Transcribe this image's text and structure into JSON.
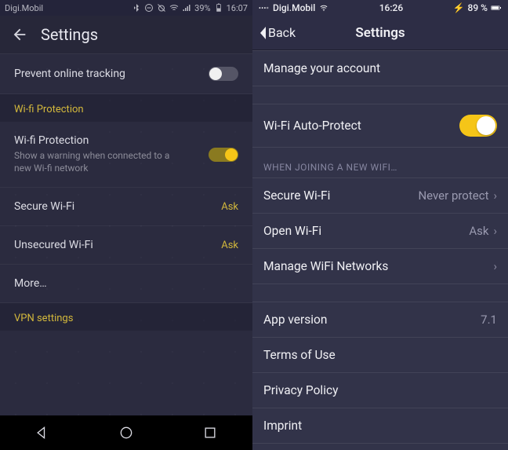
{
  "android": {
    "status": {
      "carrier": "Digi.Mobil",
      "battery_pct": "39%",
      "time": "16:07"
    },
    "title": "Settings",
    "rows": {
      "prevent_tracking": {
        "label": "Prevent online tracking"
      },
      "section_wifi": "Wi-fi Protection",
      "wifi_protection": {
        "label": "Wi-fi Protection",
        "sub": "Show a warning when connected to a new Wi-fi network"
      },
      "secure_wifi": {
        "label": "Secure Wi-Fi",
        "value": "Ask"
      },
      "unsecured_wifi": {
        "label": "Unsecured Wi-Fi",
        "value": "Ask"
      },
      "more": {
        "label": "More…"
      },
      "section_vpn": "VPN settings"
    }
  },
  "ios": {
    "status": {
      "carrier": "Digi.Mobil",
      "time": "16:26",
      "battery_pct": "89 %",
      "charging_glyph": "⚡"
    },
    "back": "Back",
    "title": "Settings",
    "rows": {
      "manage_account": {
        "label": "Manage your account"
      },
      "wifi_autoprotect": {
        "label": "Wi-Fi Auto-Protect"
      },
      "group_new_wifi": "WHEN JOINING A NEW WIFI…",
      "secure_wifi": {
        "label": "Secure Wi-Fi",
        "value": "Never protect"
      },
      "open_wifi": {
        "label": "Open Wi-Fi",
        "value": "Ask"
      },
      "manage_networks": {
        "label": "Manage WiFi Networks"
      },
      "app_version": {
        "label": "App version",
        "value": "7.1"
      },
      "terms": {
        "label": "Terms of Use"
      },
      "privacy": {
        "label": "Privacy Policy"
      },
      "imprint": {
        "label": "Imprint"
      }
    }
  }
}
